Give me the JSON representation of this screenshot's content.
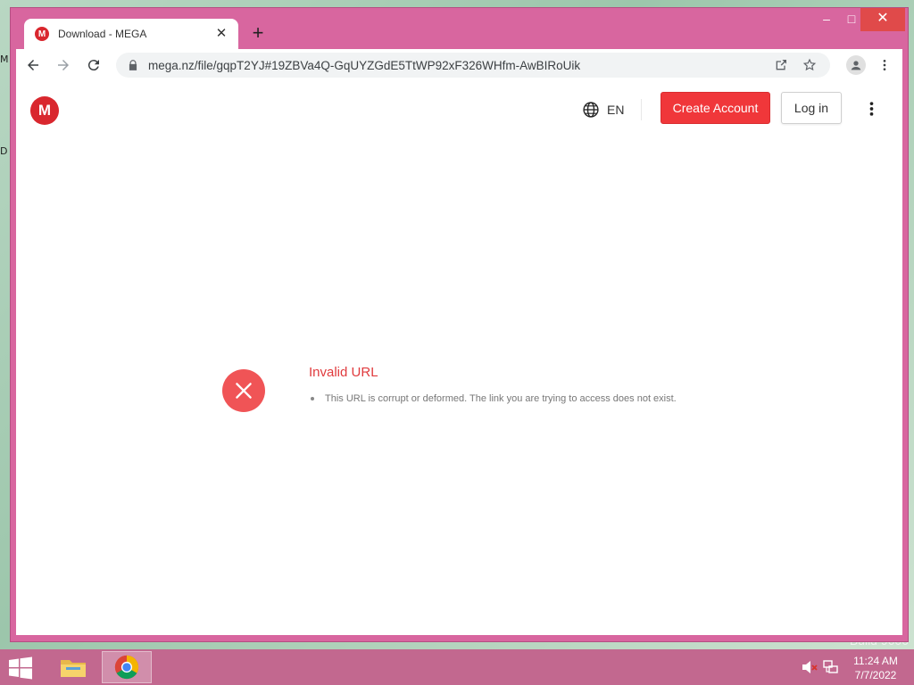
{
  "desktop": {
    "edge_top": "M",
    "edge_mid": "D",
    "watermark_line1": "o",
    "watermark_line2": "Build 9600"
  },
  "browser": {
    "tab": {
      "title": "Download - MEGA",
      "favicon": "M"
    },
    "new_tab_icon": "plus-icon",
    "window_controls": {
      "minimize": "–",
      "maximize": "□",
      "close": "✕"
    },
    "address": {
      "url": "mega.nz/file/gqpT2YJ#19ZBVa4Q-GqUYZGdE5TtWP92xF326WHfm-AwBIRoUik"
    }
  },
  "page": {
    "logo": "M",
    "language": "EN",
    "create_account": "Create Account",
    "login": "Log in",
    "error": {
      "title": "Invalid URL",
      "messages": [
        "This URL is corrupt or deformed. The link you are trying to access does not exist."
      ]
    }
  },
  "taskbar": {
    "time": "11:24 AM",
    "date": "7/7/2022"
  },
  "colors": {
    "window_frame": "#d8669f",
    "mega_red": "#d9272e",
    "create_btn": "#f0373a",
    "error_red": "#f05456",
    "taskbar": "#c2688f"
  }
}
